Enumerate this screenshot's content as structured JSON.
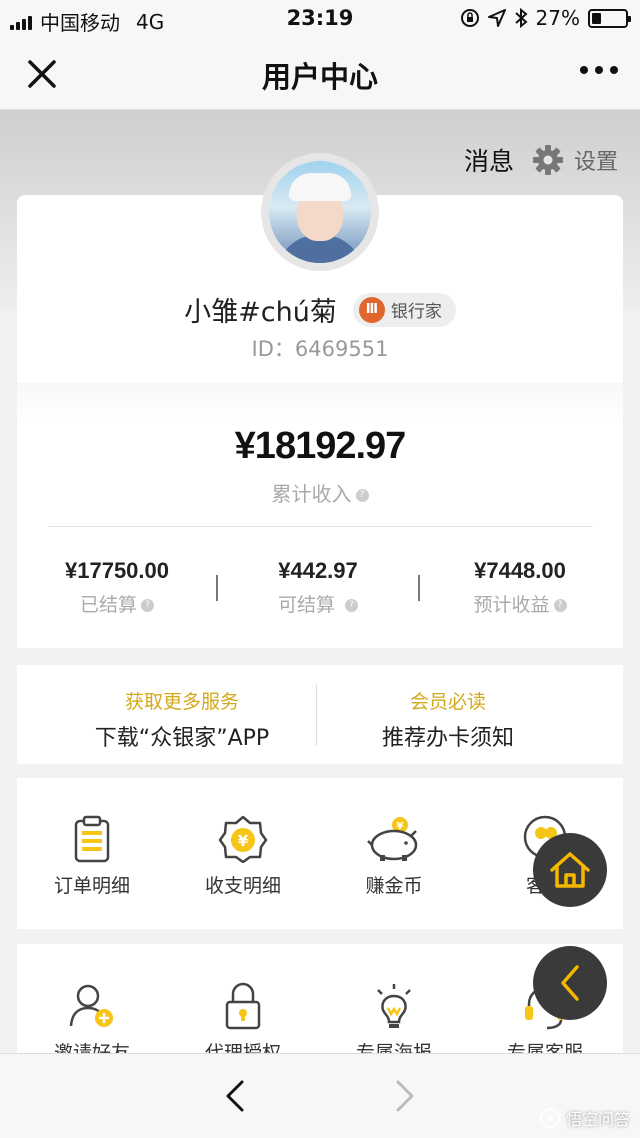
{
  "status_bar": {
    "carrier": "中国移动",
    "network": "4G",
    "time": "23:19",
    "battery": "27%",
    "battery_level": 0.27
  },
  "nav": {
    "title": "用户中心"
  },
  "header": {
    "messages": "消息",
    "settings": "设置"
  },
  "profile": {
    "name": "小雏#chú菊",
    "badge_icon": "Ⅲ",
    "badge": "银行家",
    "id": "ID：6469551"
  },
  "income": {
    "total": "¥18192.97",
    "total_label": "累计收入",
    "stats": [
      {
        "value": "¥17750.00",
        "label": "已结算"
      },
      {
        "value": "¥442.97",
        "label": "可结算"
      },
      {
        "value": "¥7448.00",
        "label": "预计收益"
      }
    ]
  },
  "services": [
    {
      "heading": "获取更多服务",
      "text": "下载“众银家”APP"
    },
    {
      "heading": "会员必读",
      "text": "推荐办卡须知"
    }
  ],
  "grid1": [
    {
      "label": "订单明细",
      "icon": "clipboard-icon"
    },
    {
      "label": "收支明细",
      "icon": "yuan-badge-icon"
    },
    {
      "label": "赚金币",
      "icon": "piggy-bank-icon"
    },
    {
      "label": "客户",
      "icon": "customers-icon"
    }
  ],
  "grid2": [
    {
      "label": "邀请好友",
      "icon": "invite-user-icon"
    },
    {
      "label": "代理授权",
      "icon": "lock-icon"
    },
    {
      "label": "专属海报",
      "icon": "lightbulb-icon"
    },
    {
      "label": "专属客服",
      "icon": "headset-icon"
    }
  ],
  "watermark": "悟空问答",
  "colors": {
    "accent_gold": "#d4a81c",
    "icon_yellow": "#f5c518",
    "badge_orange": "#e0662e",
    "fab_dark": "#3a3a3a"
  }
}
